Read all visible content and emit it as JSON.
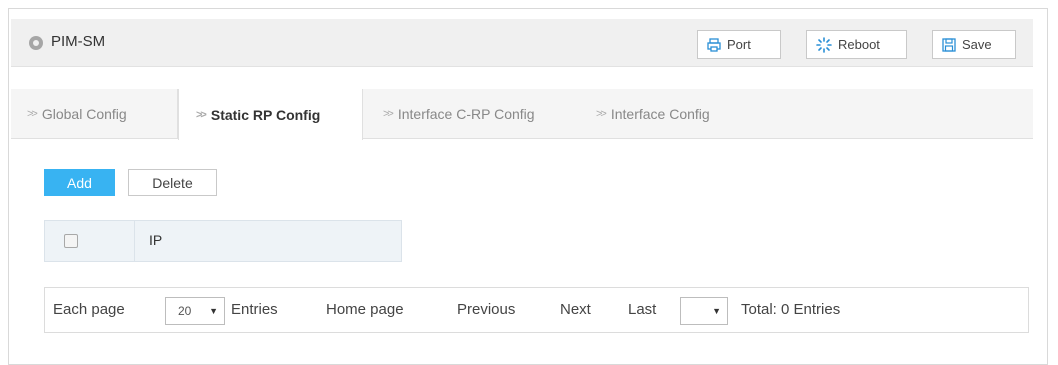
{
  "header": {
    "title": "PIM-SM",
    "buttons": {
      "port": "Port",
      "reboot": "Reboot",
      "save": "Save"
    }
  },
  "tabs": [
    {
      "label": "Global Config",
      "active": false
    },
    {
      "label": "Static RP Config",
      "active": true
    },
    {
      "label": "Interface C-RP Config",
      "active": false
    },
    {
      "label": "Interface Config",
      "active": false
    }
  ],
  "actions": {
    "add": "Add",
    "delete": "Delete"
  },
  "table": {
    "columns": [
      "IP"
    ],
    "rows": []
  },
  "pager": {
    "each_page": "Each page",
    "page_size": "20",
    "entries": "Entries",
    "home": "Home page",
    "previous": "Previous",
    "next": "Next",
    "last": "Last",
    "page_select": "",
    "total": "Total: 0 Entries"
  },
  "colors": {
    "accent": "#38b3f2",
    "header_bg": "#f0f0f0",
    "table_header_bg": "#eef3f7"
  },
  "icons": {
    "header": "circle-dot-icon",
    "port": "printer-icon",
    "reboot": "spinner-icon",
    "save": "floppy-disk-icon",
    "tab": "chevron-right-icon"
  }
}
